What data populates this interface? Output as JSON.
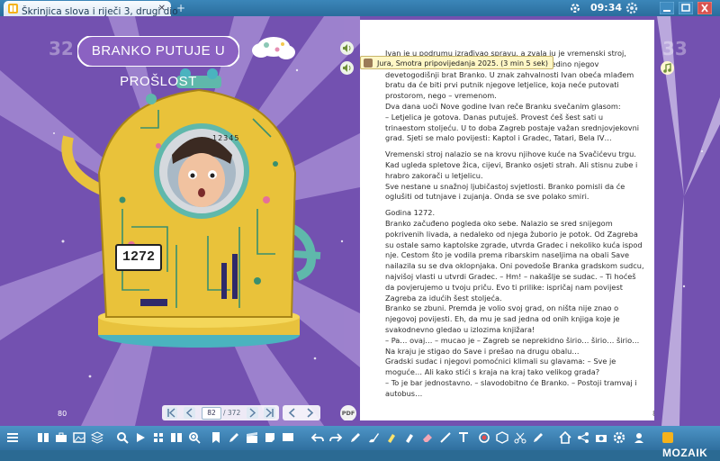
{
  "window": {
    "tab_title": "Škrinjica slova i riječi 3, drugi dio",
    "tab_close": "✕",
    "new_tab": "+",
    "clock": "09:34"
  },
  "tooltip": {
    "text": "Jura, Smotra pripovijedanja 2025. (3 min 5 sek)"
  },
  "left_page": {
    "title": "BRANKO PUTUJE U PROŠLOST",
    "page_number": "80",
    "pdf_label": "PDF",
    "machine_sign": "1272",
    "machine_digits": "12345"
  },
  "right_page": {
    "page_number": "81",
    "paragraphs": [
      {
        "text": "Ivan je u podrumu izrađivao spravu, a zvala ju je vremenski stroj, znala je cijela kuća, ali je to ozbiljno shvatio jedino njegov devetogodišnji brat Branko. U znak zahvalnosti Ivan obeća mlađem bratu da će biti prvi putnik njegove letjelice, koja neće putovati prostorom, nego – vremenom.",
        "gap": false
      },
      {
        "text": "Dva dana uoči Nove godine Ivan reče Branku svečanim glasom:",
        "gap": false
      },
      {
        "text": "– Letjelica je gotova. Danas putuješ. Provest ćeš šest sati u trinaestom stoljeću. U to doba Zagreb postaje važan srednjovjekovni grad. Sjeti se malo povijesti: Kaptol i Gradec, Tatari, Bela IV…",
        "gap": false
      },
      {
        "text": "Vremenski stroj nalazio se na krovu njihove kuće na Svačićevu trgu. Kad ugleda spletove žica, cijevi, Branko osjeti strah. Ali stisnu zube i hrabro zakorači u letjelicu.",
        "gap": true
      },
      {
        "text": "Sve nestane u snažnoj ljubičastoj svjetlosti. Branko pomisli da će oglušiti od tutnjave i zujanja. Onda se sve polako smiri.",
        "gap": false
      },
      {
        "text": "Godina 1272.",
        "gap": true
      },
      {
        "text": "Branko začuđeno pogleda oko sebe. Nalazio se sred snijegom pokrivenih livada, a nedaleko od njega žuborio je potok. Od Zagreba su ostale samo kaptolske zgrade, utvrda Gradec i nekoliko kuća ispod nje. Cestom što je vodila prema ribarskim naseljima na obali Save nailazila su se dva oklopnjaka. Oni povedoše Branka gradskom sudcu, najvišoj vlasti u utvrdi Gradec. – Hm! – nakašlje se sudac. – Ti hoćeš da povjerujemo u tvoju priču. Evo ti prilike: ispričaj nam povijest Zagreba za idućih šest stoljeća.",
        "gap": false
      },
      {
        "text": "Branko se zbuni. Premda je volio svoj grad, on ništa nije znao o njegovoj povijesti. Eh, da mu je sad jedna od onih knjiga koje je svakodnevno gledao u izlozima knjižara!",
        "gap": false
      },
      {
        "text": "– Pa… ovaj… – mucao je – Zagreb se neprekidno širio… širio… širio… Na kraju je stigao do Save i prešao na drugu obalu…",
        "gap": false
      },
      {
        "text": "Gradski sudac i njegovi pomoćnici klimali su glavama: – Sve je moguće… Ali kako stići s kraja na kraj tako velikog grada?",
        "gap": false
      },
      {
        "text": "– To je bar jednostavno. – slavodobitno će Branko. – Postoji tramvaj i autobus…",
        "gap": false
      }
    ]
  },
  "corner_numbers": {
    "left": "32",
    "right": "33"
  },
  "pager": {
    "current_page": "82",
    "total": "/ 372"
  },
  "toolbar": {
    "logo_text": "MOZAIK"
  },
  "colors": {
    "purple_bg": "#7a59b5",
    "ray_light": "#d6c8ee",
    "machine_yellow": "#e9c23a",
    "toolbar_blue": "#3d82b5",
    "tooltip_bg": "#fff7c6"
  },
  "icons": {
    "tab": "mozaik-book-icon",
    "sound": "speaker-icon",
    "music": "music-note-icon",
    "first": "first-page-icon",
    "prev": "previous-page-icon",
    "next": "next-page-icon",
    "last": "last-page-icon",
    "clock_settings": "gear-icon"
  }
}
